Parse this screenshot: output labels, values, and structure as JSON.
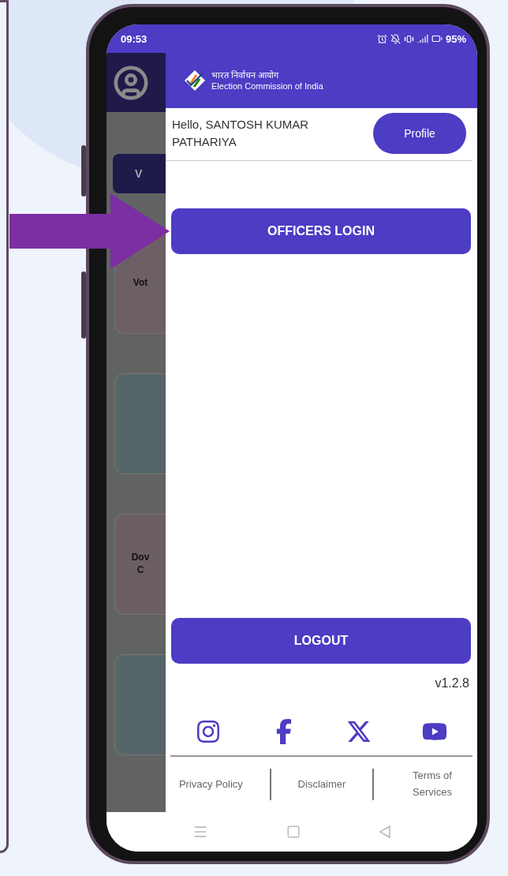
{
  "status_bar": {
    "time": "09:53",
    "battery": "95%"
  },
  "background_screen": {
    "button_text": "V",
    "cards": [
      {
        "kind": "text",
        "lines": [
          "Vot"
        ],
        "color": "#6d5f66"
      },
      {
        "kind": "blank",
        "color": "#566568"
      },
      {
        "kind": "text",
        "lines": [
          "Dov",
          "C"
        ],
        "color": "#6b5e65"
      },
      {
        "kind": "blank",
        "color": "#566568"
      }
    ]
  },
  "drawer": {
    "org_hindi": "भारत निर्वाचन आयोग",
    "org_english": "Election Commission of India",
    "greeting": "Hello, SANTOSH KUMAR PATHARIYA",
    "profile_button": "Profile",
    "officers_login": "OFFICERS LOGIN",
    "logout": "LOGOUT",
    "version": "v1.2.8",
    "social": [
      {
        "kind": "instagram"
      },
      {
        "kind": "facebook"
      },
      {
        "kind": "x"
      },
      {
        "kind": "youtube"
      }
    ],
    "footer_links": [
      "Privacy Policy",
      "Disclaimer",
      "Terms of Services"
    ]
  }
}
